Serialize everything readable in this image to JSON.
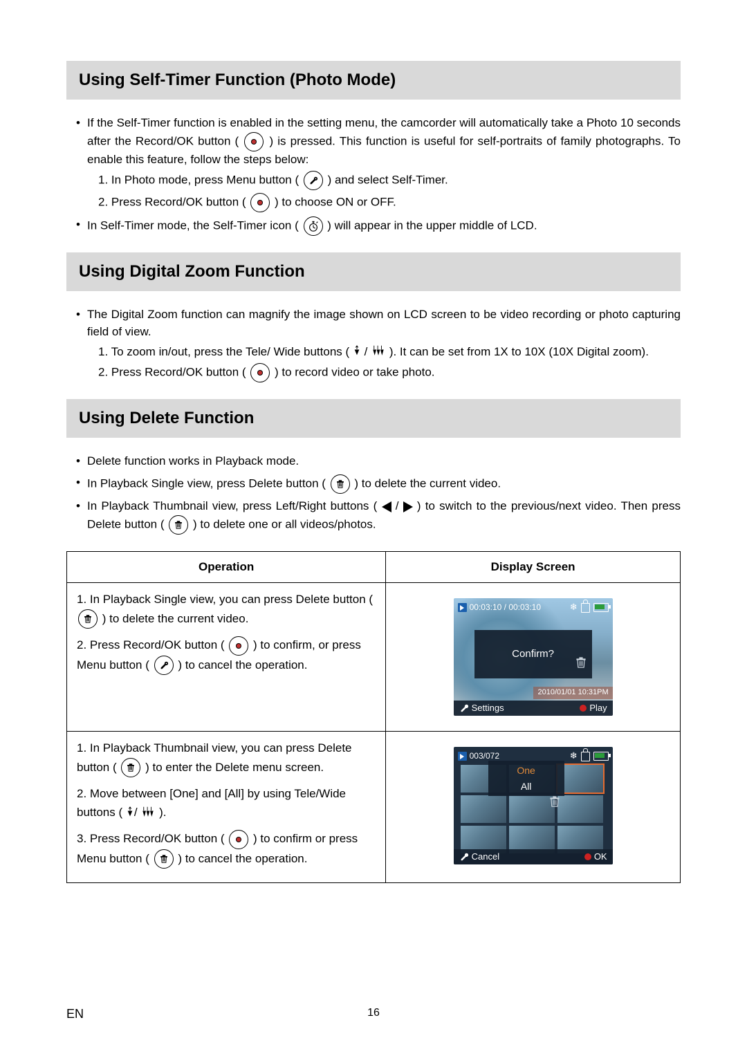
{
  "sections": {
    "selftimer": {
      "title": "Using Self-Timer Function (Photo Mode)",
      "b1a": "If the Self-Timer function is enabled in the setting menu, the camcorder will automatically take a Photo 10 seconds after the Record/OK button ( ",
      "b1b": " ) is pressed. This function is useful for self-portraits of family photographs. To enable this feature, follow the steps below:",
      "s1a": "1. In Photo mode, press Menu button ( ",
      "s1b": " ) and select Self-Timer.",
      "s2a": "2. Press Record/OK button ( ",
      "s2b": " ) to choose ON or OFF.",
      "b2a": "In Self-Timer mode, the Self-Timer icon ( ",
      "b2b": " ) will appear in the upper middle of LCD."
    },
    "zoom": {
      "title": "Using Digital Zoom Function",
      "b1": "The Digital Zoom function can magnify the image shown on LCD screen to be video recording or photo capturing field of view.",
      "s1a": "1. To zoom in/out, press the Tele/ Wide buttons ( ",
      "s1b": " ). It can be set from 1X to 10X (10X Digital zoom).",
      "s2a": "2. Press Record/OK button ( ",
      "s2b": " ) to record video or take photo."
    },
    "delete": {
      "title": "Using Delete Function",
      "b1": "Delete function works in Playback mode.",
      "b2a": "In Playback Single view, press Delete button ( ",
      "b2b": " ) to delete the current video.",
      "b3a": "In Playback Thumbnail view, press Left/Right buttons ( ",
      "b3b": " ) to switch to the previous/next video. Then press Delete button ( ",
      "b3c": " ) to delete one or all videos/photos."
    }
  },
  "table": {
    "headers": {
      "operation": "Operation",
      "screen": "Display Screen"
    },
    "row1": {
      "s1a": "1. In Playback Single view, you can press Delete button ( ",
      "s1b": " ) to delete the current video.",
      "s2a": "2. Press Record/OK button ( ",
      "s2b": " ) to confirm, or press Menu button ( ",
      "s2c": " ) to cancel the operation."
    },
    "row2": {
      "s1a": "1. In Playback Thumbnail view, you can press Delete button ( ",
      "s1b": " ) to enter the Delete menu screen.",
      "s2a": "2. Move between [One] and [All] by using Tele/Wide buttons ( ",
      "s2b": " ).",
      "s3a": "3. Press Record/OK button ( ",
      "s3b": " ) to confirm or press Menu button ( ",
      "s3c": " ) to cancel the operation."
    }
  },
  "lcd1": {
    "time": "00:03:10 / 00:03:10",
    "confirm": "Confirm?",
    "date": "2010/01/01 10:31PM",
    "left": "Settings",
    "right": "Play"
  },
  "lcd2": {
    "count": "003/072",
    "one": "One",
    "all": "All",
    "left": "Cancel",
    "right": "OK"
  },
  "footer": {
    "lang": "EN",
    "page": "16"
  }
}
